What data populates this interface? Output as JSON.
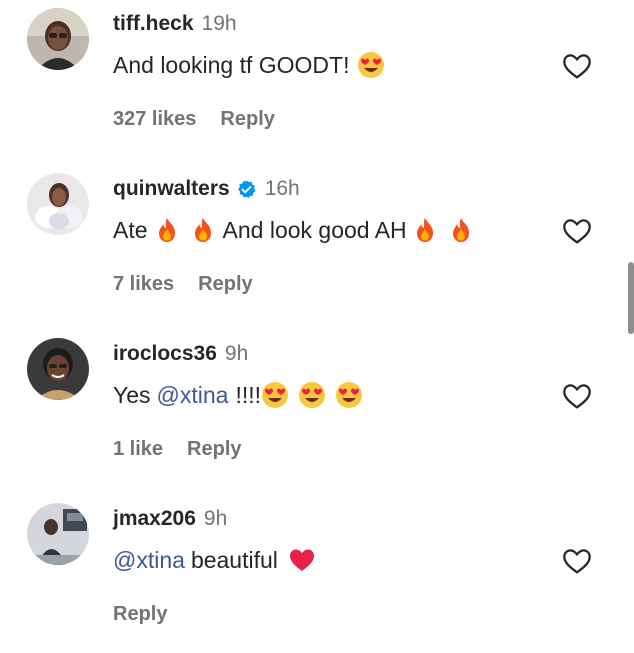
{
  "comments": [
    {
      "username": "tiff.heck",
      "verified": false,
      "time": "19h",
      "text_parts": [
        "And looking tf GOODT!"
      ],
      "emojis": [
        "heart-eyes-emoji"
      ],
      "likes": "327 likes",
      "reply_label": "Reply"
    },
    {
      "username": "quinwalters",
      "verified": true,
      "time": "16h",
      "text_parts": [
        "Ate",
        "And look good AH"
      ],
      "emojis": [
        "fire-emoji",
        "fire-emoji",
        "fire-emoji",
        "fire-emoji"
      ],
      "likes": "7 likes",
      "reply_label": "Reply"
    },
    {
      "username": "iroclocs36",
      "verified": false,
      "time": "9h",
      "text_parts": [
        "Yes",
        "@xtina",
        "!!!!"
      ],
      "emojis": [
        "heart-eyes-emoji",
        "heart-eyes-emoji",
        "heart-eyes-emoji"
      ],
      "likes": "1 like",
      "reply_label": "Reply"
    },
    {
      "username": "jmax206",
      "verified": false,
      "time": "9h",
      "text_parts": [
        "@xtina",
        "beautiful"
      ],
      "emojis": [
        "red-heart-emoji"
      ],
      "likes": "",
      "reply_label": "Reply"
    }
  ],
  "colors": {
    "text": "#262626",
    "secondary": "#737373",
    "mention": "#3b5998",
    "verified": "#0095f6"
  }
}
